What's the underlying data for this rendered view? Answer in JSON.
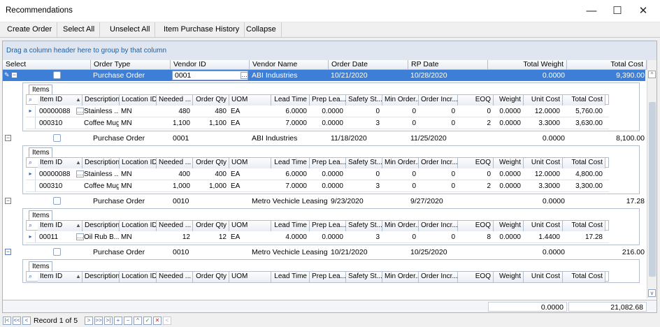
{
  "window": {
    "title": "Recommendations",
    "minimize": "—",
    "maximize": "☐",
    "close": "✕"
  },
  "toolbar": {
    "create_order": "Create Order",
    "select_all": "Select All",
    "unselect_all": "Unselect All",
    "item_purchase_history": "Item Purchase History",
    "collapse": "Collapse"
  },
  "grid": {
    "group_panel": "Drag a column header here to group by that column",
    "columns": {
      "select": "Select",
      "order_type": "Order Type",
      "vendor_id": "Vendor ID",
      "vendor_name": "Vendor Name",
      "order_date": "Order Date",
      "rp_date": "RP Date",
      "total_weight": "Total Weight",
      "total_cost": "Total Cost"
    },
    "sub_tab": "Items",
    "sub_columns": {
      "item_id": "Item ID",
      "description": "Description",
      "location_id": "Location ID",
      "needed": "Needed ...",
      "order_qty": "Order Qty",
      "uom": "UOM",
      "lead_time": "Lead Time",
      "prep_lead": "Prep Lea...",
      "safety_stock": "Safety St...",
      "min_order": "Min Order...",
      "order_incr": "Order Incr...",
      "eoq": "EOQ",
      "weight": "Weight",
      "unit_cost": "Unit Cost",
      "total_cost": "Total Cost"
    },
    "groups": [
      {
        "order_type": "Purchase Order",
        "vendor_id": "0001",
        "vendor_name": "ABI Industries",
        "order_date": "10/21/2020",
        "rp_date": "10/28/2020",
        "total_weight": "0.0000",
        "total_cost": "9,390.00",
        "items": [
          {
            "item_id": "00000088",
            "description": "Stainless ...",
            "location_id": "MN",
            "needed": "480",
            "order_qty": "480",
            "uom": "EA",
            "lead_time": "6.0000",
            "prep_lead": "0.0000",
            "safety_stock": "0",
            "min_order": "0",
            "order_incr": "0",
            "eoq": "0",
            "weight": "0.0000",
            "unit_cost": "12.0000",
            "total_cost": "5,760.00"
          },
          {
            "item_id": "000310",
            "description": "Coffee Mug",
            "location_id": "MN",
            "needed": "1,100",
            "order_qty": "1,100",
            "uom": "EA",
            "lead_time": "7.0000",
            "prep_lead": "0.0000",
            "safety_stock": "3",
            "min_order": "0",
            "order_incr": "0",
            "eoq": "2",
            "weight": "0.0000",
            "unit_cost": "3.3000",
            "total_cost": "3,630.00"
          }
        ]
      },
      {
        "order_type": "Purchase Order",
        "vendor_id": "0001",
        "vendor_name": "ABI Industries",
        "order_date": "11/18/2020",
        "rp_date": "11/25/2020",
        "total_weight": "0.0000",
        "total_cost": "8,100.00",
        "items": [
          {
            "item_id": "00000088",
            "description": "Stainless ...",
            "location_id": "MN",
            "needed": "400",
            "order_qty": "400",
            "uom": "EA",
            "lead_time": "6.0000",
            "prep_lead": "0.0000",
            "safety_stock": "0",
            "min_order": "0",
            "order_incr": "0",
            "eoq": "0",
            "weight": "0.0000",
            "unit_cost": "12.0000",
            "total_cost": "4,800.00"
          },
          {
            "item_id": "000310",
            "description": "Coffee Mug",
            "location_id": "MN",
            "needed": "1,000",
            "order_qty": "1,000",
            "uom": "EA",
            "lead_time": "7.0000",
            "prep_lead": "0.0000",
            "safety_stock": "3",
            "min_order": "0",
            "order_incr": "0",
            "eoq": "2",
            "weight": "0.0000",
            "unit_cost": "3.3000",
            "total_cost": "3,300.00"
          }
        ]
      },
      {
        "order_type": "Purchase Order",
        "vendor_id": "0010",
        "vendor_name": "Metro Vechicle Leasing ...",
        "order_date": "9/23/2020",
        "rp_date": "9/27/2020",
        "total_weight": "0.0000",
        "total_cost": "17.28",
        "items": [
          {
            "item_id": "00011",
            "description": "Oil Rub B...",
            "location_id": "MN",
            "needed": "12",
            "order_qty": "12",
            "uom": "EA",
            "lead_time": "4.0000",
            "prep_lead": "0.0000",
            "safety_stock": "3",
            "min_order": "0",
            "order_incr": "0",
            "eoq": "8",
            "weight": "0.0000",
            "unit_cost": "1.4400",
            "total_cost": "17.28"
          }
        ]
      },
      {
        "order_type": "Purchase Order",
        "vendor_id": "0010",
        "vendor_name": "Metro Vechicle Leasing ...",
        "order_date": "10/21/2020",
        "rp_date": "10/25/2020",
        "total_weight": "0.0000",
        "total_cost": "216.00",
        "items": []
      }
    ],
    "summary": {
      "total_weight": "0.0000",
      "total_cost": "21,082.68"
    }
  },
  "navigator": {
    "record_text": "Record 1 of 5"
  }
}
